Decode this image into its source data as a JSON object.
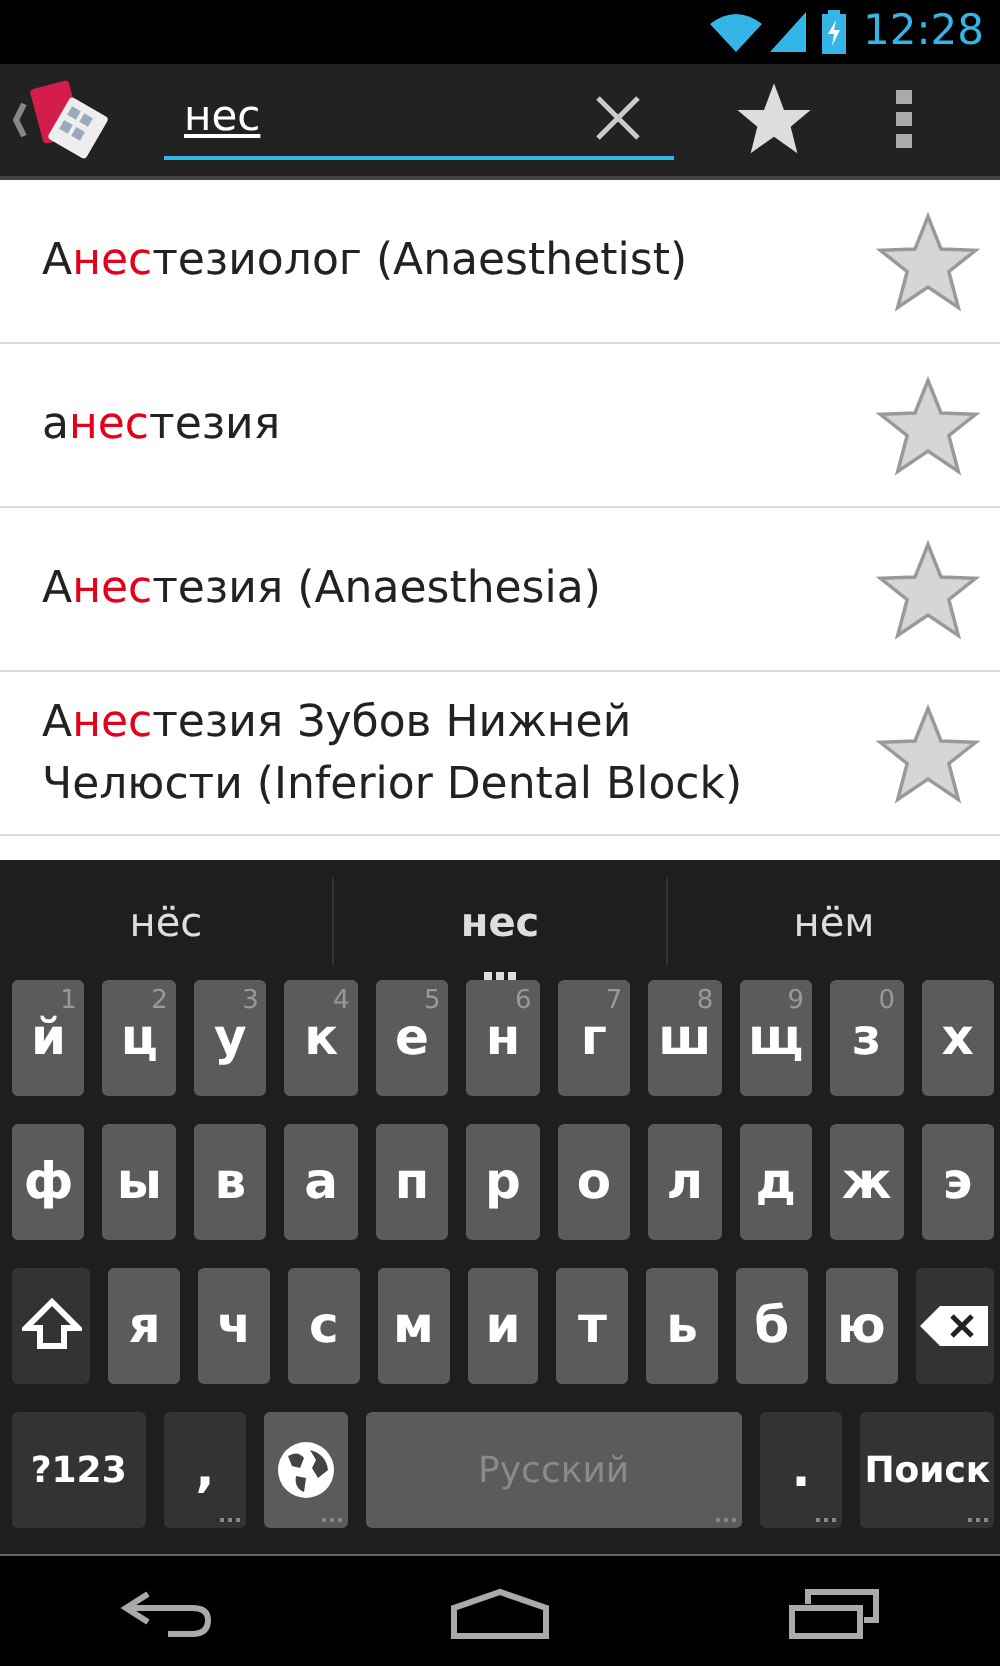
{
  "status_bar": {
    "time": "12:28"
  },
  "search": {
    "value": "нес"
  },
  "results": [
    {
      "before": "А",
      "match": "нес",
      "after": "тезиолог (Anaesthetist)",
      "starred": false
    },
    {
      "before": "а",
      "match": "нес",
      "after": "тезия",
      "starred": false
    },
    {
      "before": "А",
      "match": "нес",
      "after": "тезия (Anaesthesia)",
      "starred": false
    },
    {
      "before": "А",
      "match": "нес",
      "after": "тезия Зубов Нижней Челюсти (Inferior Dental Block)",
      "starred": false
    }
  ],
  "suggestions": [
    {
      "text": "нёс",
      "selected": false
    },
    {
      "text": "нес",
      "selected": true
    },
    {
      "text": "нём",
      "selected": false
    }
  ],
  "keyboard_rows": [
    [
      {
        "kind": "letter",
        "label": "й",
        "hint": "1"
      },
      {
        "kind": "letter",
        "label": "ц",
        "hint": "2"
      },
      {
        "kind": "letter",
        "label": "у",
        "hint": "3"
      },
      {
        "kind": "letter",
        "label": "к",
        "hint": "4"
      },
      {
        "kind": "letter",
        "label": "е",
        "hint": "5"
      },
      {
        "kind": "letter",
        "label": "н",
        "hint": "6"
      },
      {
        "kind": "letter",
        "label": "г",
        "hint": "7"
      },
      {
        "kind": "letter",
        "label": "ш",
        "hint": "8"
      },
      {
        "kind": "letter",
        "label": "щ",
        "hint": "9"
      },
      {
        "kind": "letter",
        "label": "з",
        "hint": "0"
      },
      {
        "kind": "letter",
        "label": "х"
      }
    ],
    [
      {
        "kind": "letter",
        "label": "ф"
      },
      {
        "kind": "letter",
        "label": "ы"
      },
      {
        "kind": "letter",
        "label": "в"
      },
      {
        "kind": "letter",
        "label": "а"
      },
      {
        "kind": "letter",
        "label": "п"
      },
      {
        "kind": "letter",
        "label": "р"
      },
      {
        "kind": "letter",
        "label": "о"
      },
      {
        "kind": "letter",
        "label": "л"
      },
      {
        "kind": "letter",
        "label": "д"
      },
      {
        "kind": "letter",
        "label": "ж"
      },
      {
        "kind": "letter",
        "label": "э"
      }
    ],
    [
      {
        "kind": "shift"
      },
      {
        "kind": "letter",
        "label": "я"
      },
      {
        "kind": "letter",
        "label": "ч"
      },
      {
        "kind": "letter",
        "label": "с"
      },
      {
        "kind": "letter",
        "label": "м"
      },
      {
        "kind": "letter",
        "label": "и"
      },
      {
        "kind": "letter",
        "label": "т"
      },
      {
        "kind": "letter",
        "label": "ь"
      },
      {
        "kind": "letter",
        "label": "б"
      },
      {
        "kind": "letter",
        "label": "ю"
      },
      {
        "kind": "backspace"
      }
    ],
    [
      {
        "kind": "symbols",
        "label": "?123"
      },
      {
        "kind": "punct",
        "label": ","
      },
      {
        "kind": "globe"
      },
      {
        "kind": "space",
        "label": "Русский"
      },
      {
        "kind": "punct",
        "label": "."
      },
      {
        "kind": "action",
        "label": "Поиск"
      }
    ]
  ]
}
